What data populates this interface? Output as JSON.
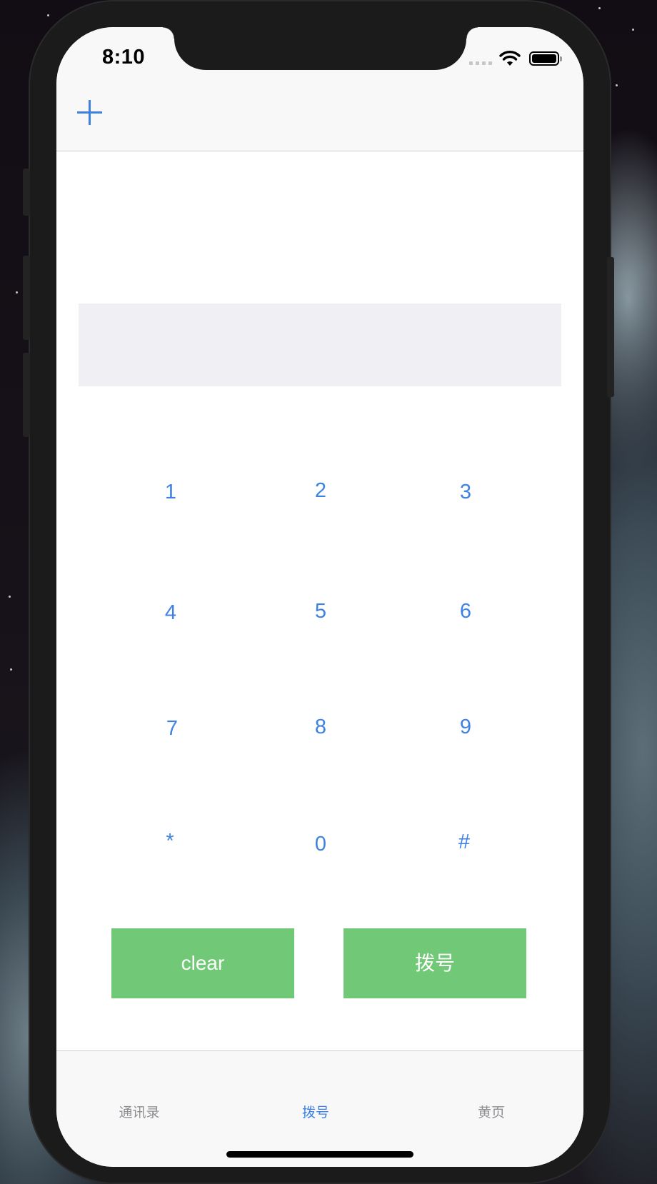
{
  "status_bar": {
    "time": "8:10",
    "icons": [
      "cellular-signal-icon",
      "wifi-icon",
      "battery-icon"
    ]
  },
  "nav_bar": {
    "add_icon": "plus-icon",
    "accent_color": "#3d82e3"
  },
  "display": {
    "number": ""
  },
  "keypad": {
    "keys": [
      "1",
      "2",
      "3",
      "4",
      "5",
      "6",
      "7",
      "8",
      "9",
      "*",
      "0",
      "#"
    ]
  },
  "actions": {
    "clear_label": "clear",
    "dial_label": "拨号",
    "button_color": "#71c877"
  },
  "tab_bar": {
    "tabs": [
      {
        "label": "通讯录",
        "active": false
      },
      {
        "label": "拨号",
        "active": true
      },
      {
        "label": "黄页",
        "active": false
      }
    ],
    "active_color": "#3d82e3",
    "inactive_color": "#8e8e93"
  }
}
